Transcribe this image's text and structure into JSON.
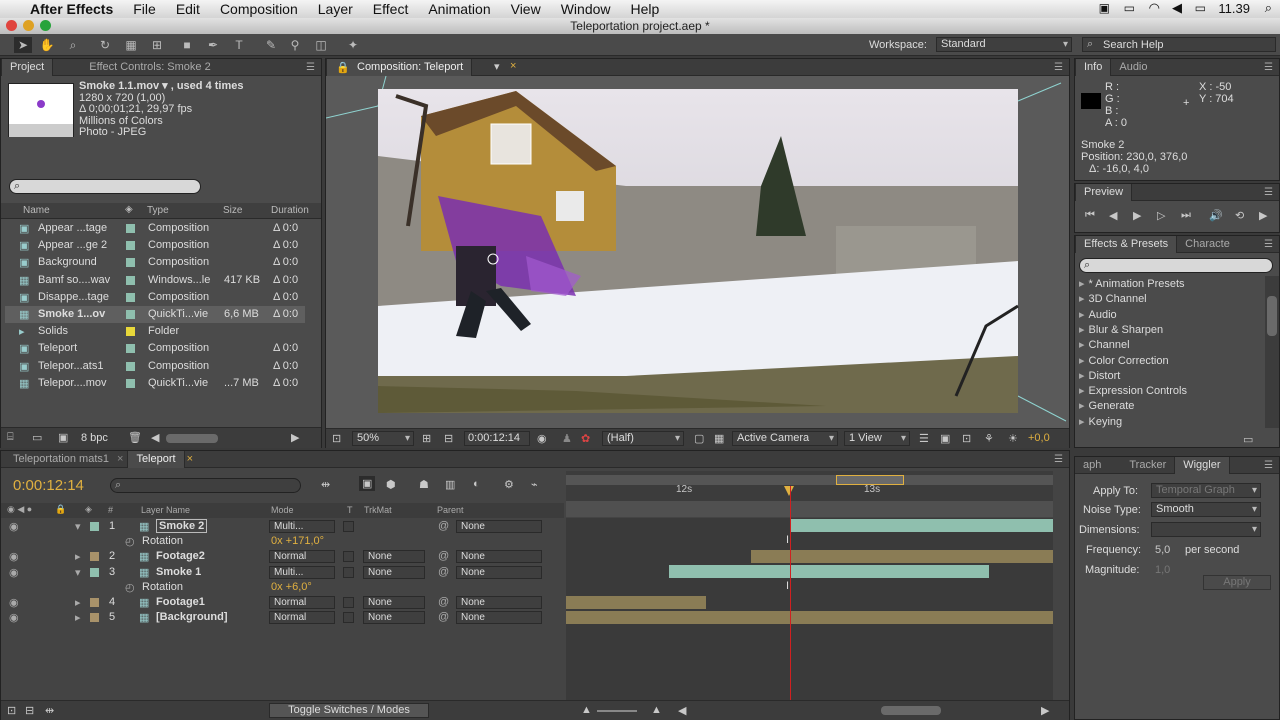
{
  "menubar": {
    "app": "After Effects",
    "items": [
      "File",
      "Edit",
      "Composition",
      "Layer",
      "Effect",
      "Animation",
      "View",
      "Window",
      "Help"
    ],
    "clock": "11.39"
  },
  "window": {
    "title": "Teleportation project.aep *"
  },
  "toolbar": {
    "workspace_label": "Workspace:",
    "workspace_value": "Standard",
    "search_placeholder": "Search Help"
  },
  "project": {
    "tabs": [
      "Project",
      "Effect Controls: Smoke 2"
    ],
    "preview": {
      "name": "Smoke 1.1.mov ▾ , used 4 times",
      "res": "1280 x 720 (1,00)",
      "dur": "Δ 0;00;01;21, 29,97 fps",
      "colors": "Millions of Colors",
      "codec": "Photo - JPEG"
    },
    "columns": {
      "name": "Name",
      "type": "Type",
      "size": "Size",
      "duration": "Duration"
    },
    "items": [
      {
        "name": "Appear ...tage",
        "type": "Composition",
        "size": "",
        "dur": "Δ 0:0"
      },
      {
        "name": "Appear ...ge 2",
        "type": "Composition",
        "size": "",
        "dur": "Δ 0:0"
      },
      {
        "name": "Background",
        "type": "Composition",
        "size": "",
        "dur": "Δ 0:0"
      },
      {
        "name": "Bamf so....wav",
        "type": "Windows...le",
        "size": "417 KB",
        "dur": "Δ 0:0"
      },
      {
        "name": "Disappe...tage",
        "type": "Composition",
        "size": "",
        "dur": "Δ 0:0"
      },
      {
        "name": "Smoke 1...ov",
        "type": "QuickTi...vie",
        "size": "6,6 MB",
        "dur": "Δ 0:0"
      },
      {
        "name": "Solids",
        "type": "Folder",
        "size": "",
        "dur": ""
      },
      {
        "name": "Teleport",
        "type": "Composition",
        "size": "",
        "dur": "Δ 0:0"
      },
      {
        "name": "Telepor...ats1",
        "type": "Composition",
        "size": "",
        "dur": "Δ 0:0"
      },
      {
        "name": "Telepor....mov",
        "type": "QuickTi...vie",
        "size": "...7 MB",
        "dur": "Δ 0:0"
      }
    ],
    "bpc": "8 bpc"
  },
  "composition": {
    "tab": "Composition: Teleport",
    "zoom": "50%",
    "timecode": "0:00:12:14",
    "quality": "(Half)",
    "camera": "Active Camera",
    "view": "1 View",
    "exposure": "+0,0"
  },
  "info": {
    "tabs": [
      "Info",
      "Audio"
    ],
    "r": "R :",
    "g": "G :",
    "b": "B :",
    "a": "A : 0",
    "x": "X : -50",
    "y": "Y : 704",
    "layer": "Smoke 2",
    "position": "Position: 230,0, 376,0",
    "delta": "Δ: -16,0, 4,0"
  },
  "preview_panel": {
    "tab": "Preview"
  },
  "effects": {
    "tabs": [
      "Effects & Presets",
      "Characte"
    ],
    "items": [
      "* Animation Presets",
      "3D Channel",
      "Audio",
      "Blur & Sharpen",
      "Channel",
      "Color Correction",
      "Distort",
      "Expression Controls",
      "Generate",
      "Keying"
    ]
  },
  "timeline": {
    "tabs": [
      "Teleportation mats1",
      "Teleport"
    ],
    "timecode": "0:00:12:14",
    "columns": {
      "num": "#",
      "layer_name": "Layer Name",
      "mode": "Mode",
      "t": "T",
      "trkmat": "TrkMat",
      "parent": "Parent"
    },
    "ruler": {
      "t12": "12s",
      "t13": "13s"
    },
    "layers": [
      {
        "num": "1",
        "name": "Smoke 2",
        "mode": "Multi...",
        "trkmat": "",
        "parent": "None"
      },
      {
        "num": "",
        "name": "Rotation",
        "value": "0x +171,0°"
      },
      {
        "num": "2",
        "name": "Footage2",
        "mode": "Normal",
        "trkmat": "None",
        "parent": "None"
      },
      {
        "num": "3",
        "name": "Smoke 1",
        "mode": "Multi...",
        "trkmat": "None",
        "parent": "None"
      },
      {
        "num": "",
        "name": "Rotation",
        "value": "0x +6,0°"
      },
      {
        "num": "4",
        "name": "Footage1",
        "mode": "Normal",
        "trkmat": "None",
        "parent": "None"
      },
      {
        "num": "5",
        "name": "[Background]",
        "mode": "Normal",
        "trkmat": "None",
        "parent": "None"
      }
    ],
    "toggle": "Toggle Switches / Modes"
  },
  "wiggler": {
    "tabs": [
      "aph",
      "Tracker",
      "Wiggler"
    ],
    "apply_to_label": "Apply To:",
    "apply_to_value": "Temporal Graph",
    "noise_label": "Noise Type:",
    "noise_value": "Smooth",
    "dimensions_label": "Dimensions:",
    "freq_label": "Frequency:",
    "freq_value": "5,0",
    "freq_unit": "per second",
    "mag_label": "Magnitude:",
    "mag_value": "1,0",
    "apply_button": "Apply"
  },
  "colors": {
    "accent": "#e0b040",
    "timeline_bar": "#8fbfae",
    "playhead": "#d02020"
  }
}
